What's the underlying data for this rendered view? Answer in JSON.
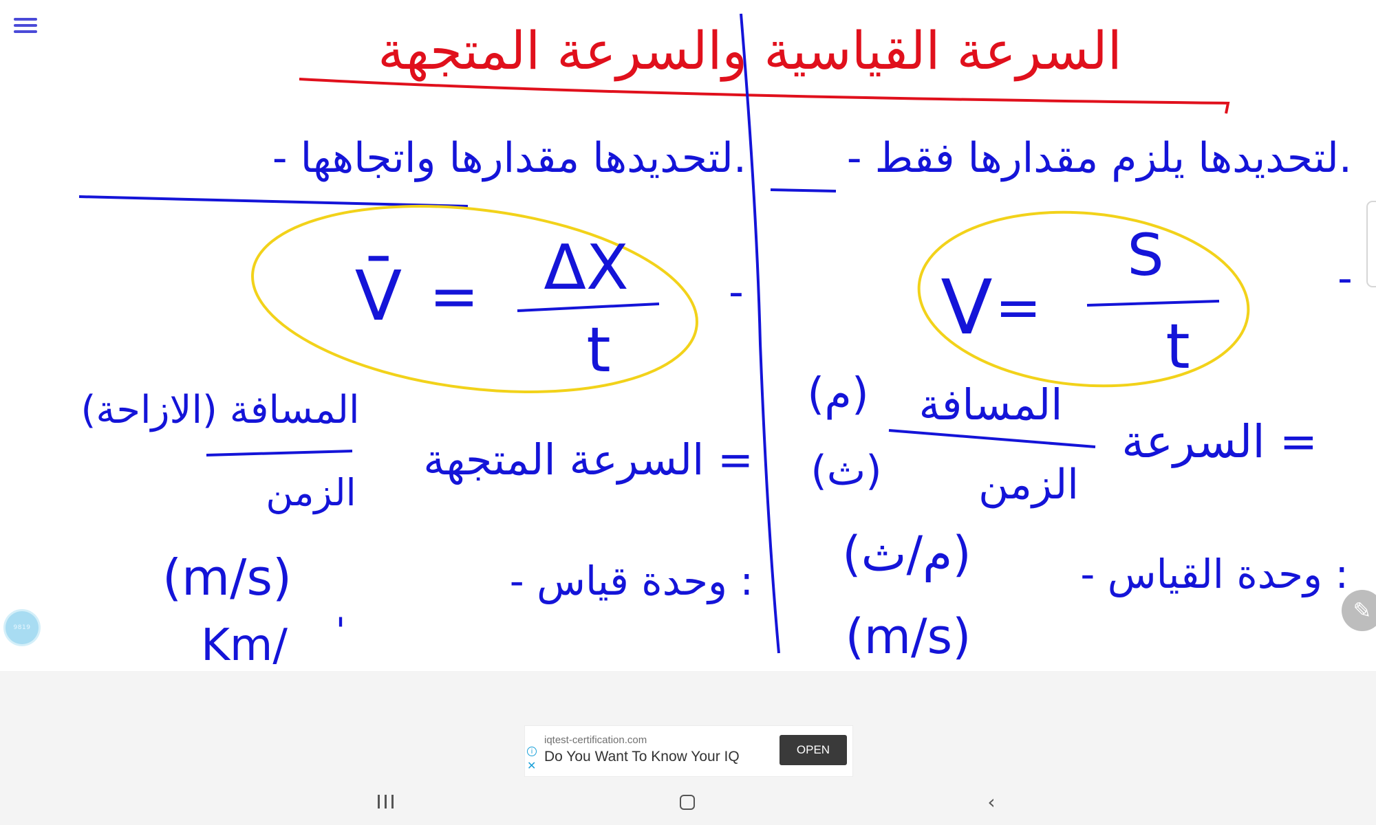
{
  "toolbar": {
    "menu_icon": "hamburger-menu-icon",
    "pen_icon": "pencil-icon",
    "bubble_label": "9819"
  },
  "whiteboard": {
    "ink_colors": {
      "title": "#e0101c",
      "body": "#1414d8",
      "highlight": "#f2d21a"
    },
    "title": "السرعة القياسية والسرعة المتجهة",
    "left_column": {
      "note": "- لتحديدها مقدارها واتجاهها.",
      "formula_symbol": "V̄",
      "formula_equals": "=",
      "formula_numerator": "ΔX",
      "formula_denominator": "t",
      "formula_dash": "-",
      "word_numerator": "المسافة (الازاحة)",
      "word_denominator": "الزمن",
      "word_result": "السرعة المتجهة =",
      "unit_label": "- وحدة قياس :",
      "unit_value": "(m/s)",
      "unit_value_2": "Km/",
      "unit_tick": "'"
    },
    "right_column": {
      "note": "- لتحديدها يلزم مقدارها فقط.",
      "formula_symbol": "V",
      "formula_equals": "=",
      "formula_numerator": "S",
      "formula_denominator": "t",
      "formula_dash": "-",
      "word_numerator": "المسافة",
      "word_numerator_unit": "(م)",
      "word_denominator": "الزمن",
      "word_denominator_unit": "(ث)",
      "word_result": "السرعة =",
      "unit_label": "- وحدة القياس :",
      "unit_value": "(م/ث)",
      "unit_value_2": "(m/s)"
    }
  },
  "ad": {
    "domain": "iqtest-certification.com",
    "headline": "Do You Want To Know Your IQ",
    "button_label": "OPEN",
    "info_icon": "info-icon",
    "close_icon": "close-icon"
  },
  "navigation": {
    "recent_icon": "recent-apps-icon",
    "home_icon": "home-icon",
    "back_icon": "back-icon"
  }
}
